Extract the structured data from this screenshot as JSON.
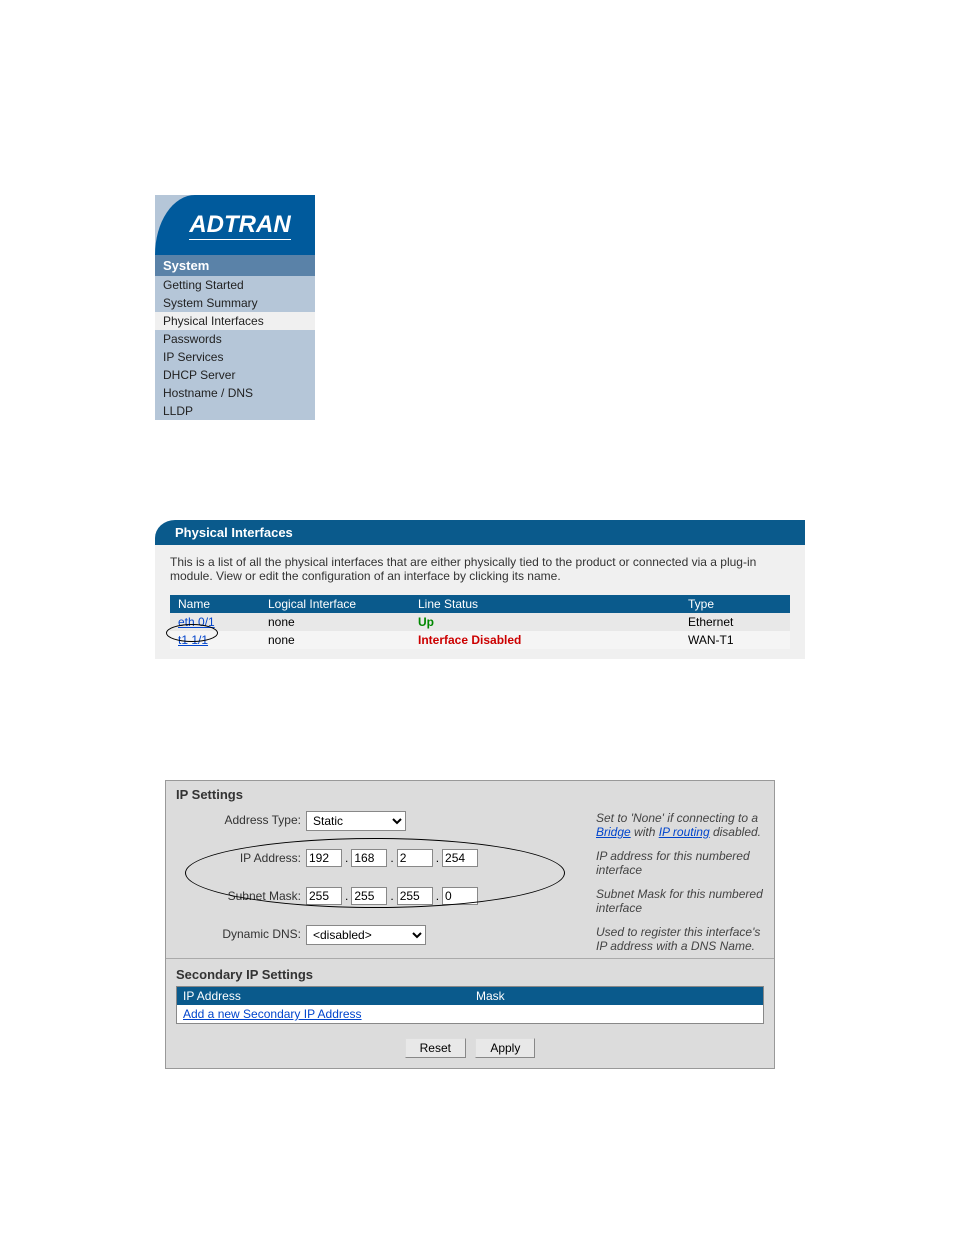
{
  "sidebar": {
    "logo": "ADTRAN",
    "header": "System",
    "items": [
      {
        "label": "Getting Started",
        "active": false
      },
      {
        "label": "System Summary",
        "active": false
      },
      {
        "label": "Physical Interfaces",
        "active": true
      },
      {
        "label": "Passwords",
        "active": false
      },
      {
        "label": "IP Services",
        "active": false
      },
      {
        "label": "DHCP Server",
        "active": false
      },
      {
        "label": "Hostname / DNS",
        "active": false
      },
      {
        "label": "LLDP",
        "active": false
      }
    ]
  },
  "pi": {
    "title": "Physical Interfaces",
    "description": "This is a list of all the physical interfaces that are either physically tied to the product or connected via a plug-in module. View or edit the configuration of an interface by clicking its name.",
    "cols": {
      "name": "Name",
      "logical": "Logical Interface",
      "status": "Line Status",
      "type": "Type"
    },
    "rows": [
      {
        "name": "eth 0/1",
        "logical": "none",
        "status": "Up",
        "statusClass": "status-up",
        "type": "Ethernet"
      },
      {
        "name": "t1 1/1",
        "logical": "none",
        "status": "Interface Disabled",
        "statusClass": "status-disabled",
        "type": "WAN-T1"
      }
    ]
  },
  "ip": {
    "title": "IP Settings",
    "addressTypeLabel": "Address Type:",
    "addressTypeValue": "Static",
    "addressTypeHelpPre": "Set to 'None' if connecting to a ",
    "addressTypeHelpLink": "Bridge",
    "addressTypeHelpMid": " with ",
    "addressTypeHelpLink2": "IP routing",
    "addressTypeHelpPost": " disabled.",
    "ipAddressLabel": "IP Address:",
    "ipAddress": [
      "192",
      "168",
      "2",
      "254"
    ],
    "ipAddressHelp": "IP address for this numbered interface",
    "subnetLabel": "Subnet Mask:",
    "subnet": [
      "255",
      "255",
      "255",
      "0"
    ],
    "subnetHelp": "Subnet Mask for this numbered interface",
    "ddnsLabel": "Dynamic DNS:",
    "ddnsValue": "<disabled>",
    "ddnsHelp": "Used to register this interface's IP address with a DNS Name.",
    "secTitle": "Secondary IP Settings",
    "secCols": {
      "ip": "IP Address",
      "mask": "Mask"
    },
    "secAddLink": "Add a new Secondary IP Address",
    "resetLabel": "Reset",
    "applyLabel": "Apply"
  }
}
